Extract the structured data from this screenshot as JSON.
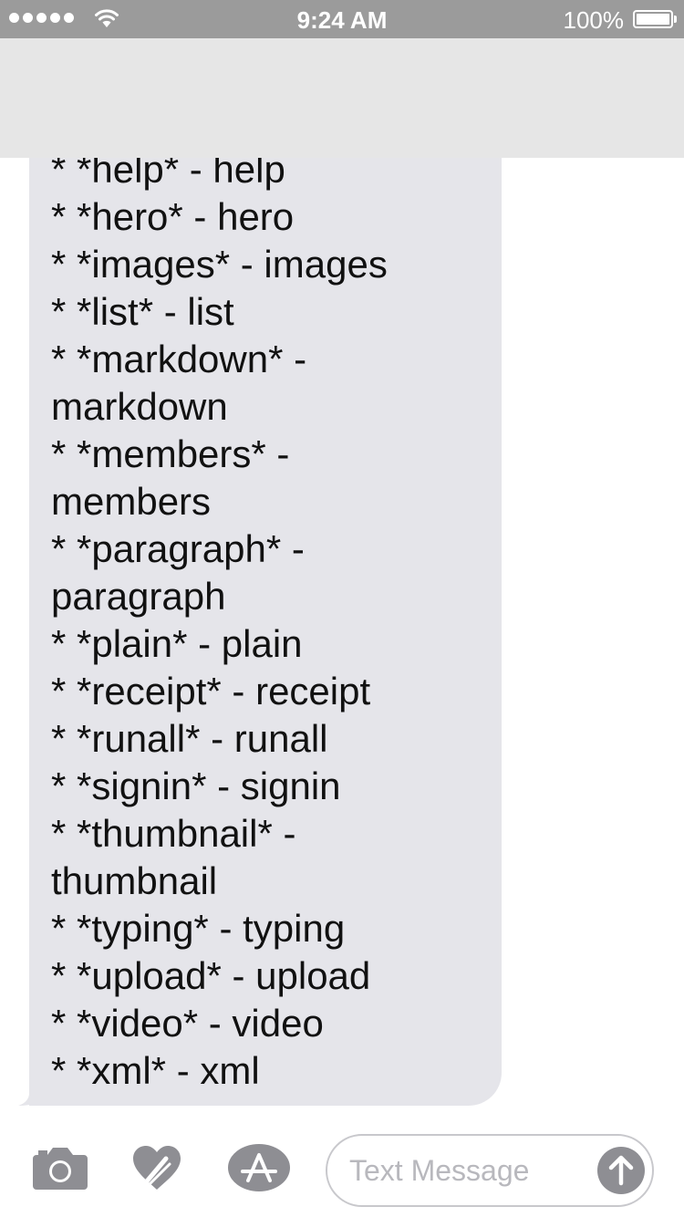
{
  "status_bar": {
    "time": "9:24 AM",
    "battery_percent": "100%",
    "signal_bars": 5,
    "battery_level": 1.0
  },
  "colors": {
    "status_bar_bg": "#9b9b9b",
    "header_bg": "#e6e6e6",
    "bubble_bg": "#e5e5ea",
    "icon_gray": "#8e8e93"
  },
  "icons": {
    "wifi": "wifi-icon",
    "camera": "camera-icon",
    "digital_touch": "digital-touch-icon",
    "app_store": "app-store-icon",
    "send": "send-arrow-icon"
  },
  "message": {
    "lines": [
      "* *help* - help",
      "* *hero* - hero",
      "* *images* - images",
      "* *list* - list",
      "* *markdown* -",
      "markdown",
      "* *members* -",
      "members",
      "* *paragraph* -",
      "paragraph",
      "* *plain* - plain",
      "* *receipt* - receipt",
      "* *runall* - runall",
      "* *signin* - signin",
      "* *thumbnail* -",
      "thumbnail",
      "* *typing* - typing",
      "* *upload* - upload",
      "* *video* - video",
      "* *xml* - xml"
    ]
  },
  "input": {
    "placeholder": "Text Message",
    "value": ""
  }
}
